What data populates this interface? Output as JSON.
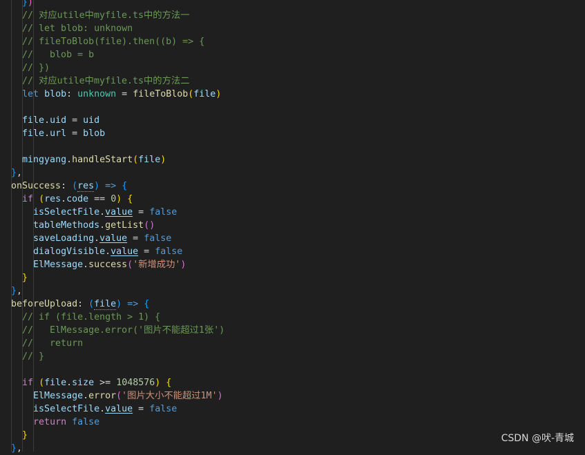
{
  "watermark": "CSDN @吠-青城",
  "lines": [
    [
      {
        "t": "    "
      },
      {
        "t": "}",
        "c": "c-b3"
      },
      {
        "t": ")",
        "c": "c-b2"
      }
    ],
    [
      {
        "t": "    // 对应utile中myfile.ts中的方法一",
        "c": "c-comment"
      }
    ],
    [
      {
        "t": "    // let blob: unknown",
        "c": "c-comment"
      }
    ],
    [
      {
        "t": "    // fileToBlob(file).then((b) => {",
        "c": "c-comment"
      }
    ],
    [
      {
        "t": "    //   blob = b",
        "c": "c-comment"
      }
    ],
    [
      {
        "t": "    // })",
        "c": "c-comment"
      }
    ],
    [
      {
        "t": "    // 对应utile中myfile.ts中的方法二",
        "c": "c-comment"
      }
    ],
    [
      {
        "t": "    "
      },
      {
        "t": "let",
        "c": "c-kw"
      },
      {
        "t": " "
      },
      {
        "t": "blob",
        "c": "c-var"
      },
      {
        "t": ": ",
        "c": "c-op"
      },
      {
        "t": "unknown",
        "c": "c-type"
      },
      {
        "t": " = ",
        "c": "c-op"
      },
      {
        "t": "fileToBlob",
        "c": "c-fn"
      },
      {
        "t": "(",
        "c": "c-b1"
      },
      {
        "t": "file",
        "c": "c-var"
      },
      {
        "t": ")",
        "c": "c-b1"
      }
    ],
    [
      {
        "t": ""
      }
    ],
    [
      {
        "t": "    "
      },
      {
        "t": "file",
        "c": "c-var"
      },
      {
        "t": ".",
        "c": "c-op"
      },
      {
        "t": "uid",
        "c": "c-var"
      },
      {
        "t": " = ",
        "c": "c-op"
      },
      {
        "t": "uid",
        "c": "c-var"
      }
    ],
    [
      {
        "t": "    "
      },
      {
        "t": "file",
        "c": "c-var"
      },
      {
        "t": ".",
        "c": "c-op"
      },
      {
        "t": "url",
        "c": "c-var"
      },
      {
        "t": " = ",
        "c": "c-op"
      },
      {
        "t": "blob",
        "c": "c-var"
      }
    ],
    [
      {
        "t": ""
      }
    ],
    [
      {
        "t": "    "
      },
      {
        "t": "mingyang",
        "c": "c-var"
      },
      {
        "t": ".",
        "c": "c-op"
      },
      {
        "t": "handleStart",
        "c": "c-fn"
      },
      {
        "t": "(",
        "c": "c-b1"
      },
      {
        "t": "file",
        "c": "c-var"
      },
      {
        "t": ")",
        "c": "c-b1"
      }
    ],
    [
      {
        "t": "  "
      },
      {
        "t": "}",
        "c": "c-b3"
      },
      {
        "t": ",",
        "c": "c-op"
      }
    ],
    [
      {
        "t": "  "
      },
      {
        "t": "onSuccess",
        "c": "c-fn"
      },
      {
        "t": ": ",
        "c": "c-op"
      },
      {
        "t": "(",
        "c": "c-b3"
      },
      {
        "t": "res",
        "c": "c-var",
        "d": true
      },
      {
        "t": ")",
        "c": "c-b3"
      },
      {
        "t": " ",
        "c": "c-op"
      },
      {
        "t": "=>",
        "c": "c-kw"
      },
      {
        "t": " ",
        "c": "c-op"
      },
      {
        "t": "{",
        "c": "c-b3"
      }
    ],
    [
      {
        "t": "    "
      },
      {
        "t": "if",
        "c": "c-ctrl"
      },
      {
        "t": " "
      },
      {
        "t": "(",
        "c": "c-b1"
      },
      {
        "t": "res",
        "c": "c-var"
      },
      {
        "t": ".",
        "c": "c-op"
      },
      {
        "t": "code",
        "c": "c-var"
      },
      {
        "t": " == ",
        "c": "c-op"
      },
      {
        "t": "0",
        "c": "c-num"
      },
      {
        "t": ")",
        "c": "c-b1"
      },
      {
        "t": " "
      },
      {
        "t": "{",
        "c": "c-b1"
      }
    ],
    [
      {
        "t": "      "
      },
      {
        "t": "isSelectFile",
        "c": "c-var"
      },
      {
        "t": ".",
        "c": "c-op"
      },
      {
        "t": "value",
        "c": "c-var",
        "u": true
      },
      {
        "t": " = ",
        "c": "c-op"
      },
      {
        "t": "false",
        "c": "c-kw"
      }
    ],
    [
      {
        "t": "      "
      },
      {
        "t": "tableMethods",
        "c": "c-var"
      },
      {
        "t": ".",
        "c": "c-op"
      },
      {
        "t": "getList",
        "c": "c-fn"
      },
      {
        "t": "()",
        "c": "c-b2"
      }
    ],
    [
      {
        "t": "      "
      },
      {
        "t": "saveLoading",
        "c": "c-var"
      },
      {
        "t": ".",
        "c": "c-op"
      },
      {
        "t": "value",
        "c": "c-var",
        "u": true
      },
      {
        "t": " = ",
        "c": "c-op"
      },
      {
        "t": "false",
        "c": "c-kw"
      }
    ],
    [
      {
        "t": "      "
      },
      {
        "t": "dialogVisible",
        "c": "c-var"
      },
      {
        "t": ".",
        "c": "c-op"
      },
      {
        "t": "value",
        "c": "c-var",
        "u": true
      },
      {
        "t": " = ",
        "c": "c-op"
      },
      {
        "t": "false",
        "c": "c-kw"
      }
    ],
    [
      {
        "t": "      "
      },
      {
        "t": "ElMessage",
        "c": "c-var"
      },
      {
        "t": ".",
        "c": "c-op"
      },
      {
        "t": "success",
        "c": "c-fn"
      },
      {
        "t": "(",
        "c": "c-b2"
      },
      {
        "t": "'新增成功'",
        "c": "c-str"
      },
      {
        "t": ")",
        "c": "c-b2"
      }
    ],
    [
      {
        "t": "    "
      },
      {
        "t": "}",
        "c": "c-b1"
      }
    ],
    [
      {
        "t": "  "
      },
      {
        "t": "}",
        "c": "c-b3"
      },
      {
        "t": ",",
        "c": "c-op"
      }
    ],
    [
      {
        "t": "  "
      },
      {
        "t": "beforeUpload",
        "c": "c-fn"
      },
      {
        "t": ": ",
        "c": "c-op"
      },
      {
        "t": "(",
        "c": "c-b3"
      },
      {
        "t": "file",
        "c": "c-var",
        "d": true
      },
      {
        "t": ")",
        "c": "c-b3"
      },
      {
        "t": " ",
        "c": "c-op"
      },
      {
        "t": "=>",
        "c": "c-kw"
      },
      {
        "t": " ",
        "c": "c-op"
      },
      {
        "t": "{",
        "c": "c-b3"
      }
    ],
    [
      {
        "t": "    // if (file.length > 1) {",
        "c": "c-comment"
      }
    ],
    [
      {
        "t": "    //   ElMessage.error('图片不能超过1张')",
        "c": "c-comment"
      }
    ],
    [
      {
        "t": "    //   return",
        "c": "c-comment"
      }
    ],
    [
      {
        "t": "    // }",
        "c": "c-comment"
      }
    ],
    [
      {
        "t": ""
      }
    ],
    [
      {
        "t": "    "
      },
      {
        "t": "if",
        "c": "c-ctrl"
      },
      {
        "t": " "
      },
      {
        "t": "(",
        "c": "c-b1"
      },
      {
        "t": "file",
        "c": "c-var"
      },
      {
        "t": ".",
        "c": "c-op"
      },
      {
        "t": "size",
        "c": "c-var"
      },
      {
        "t": " >= ",
        "c": "c-op"
      },
      {
        "t": "1048576",
        "c": "c-num"
      },
      {
        "t": ")",
        "c": "c-b1"
      },
      {
        "t": " "
      },
      {
        "t": "{",
        "c": "c-b1"
      }
    ],
    [
      {
        "t": "      "
      },
      {
        "t": "ElMessage",
        "c": "c-var"
      },
      {
        "t": ".",
        "c": "c-op"
      },
      {
        "t": "error",
        "c": "c-fn"
      },
      {
        "t": "(",
        "c": "c-b2"
      },
      {
        "t": "'图片大小不能超过1M'",
        "c": "c-str"
      },
      {
        "t": ")",
        "c": "c-b2"
      }
    ],
    [
      {
        "t": "      "
      },
      {
        "t": "isSelectFile",
        "c": "c-var"
      },
      {
        "t": ".",
        "c": "c-op"
      },
      {
        "t": "value",
        "c": "c-var",
        "u": true
      },
      {
        "t": " = ",
        "c": "c-op"
      },
      {
        "t": "false",
        "c": "c-kw"
      }
    ],
    [
      {
        "t": "      "
      },
      {
        "t": "return",
        "c": "c-ctrl"
      },
      {
        "t": " "
      },
      {
        "t": "false",
        "c": "c-kw"
      }
    ],
    [
      {
        "t": "    "
      },
      {
        "t": "}",
        "c": "c-b1"
      }
    ],
    [
      {
        "t": "  "
      },
      {
        "t": "}",
        "c": "c-b3"
      },
      {
        "t": ",",
        "c": "c-op"
      }
    ]
  ]
}
